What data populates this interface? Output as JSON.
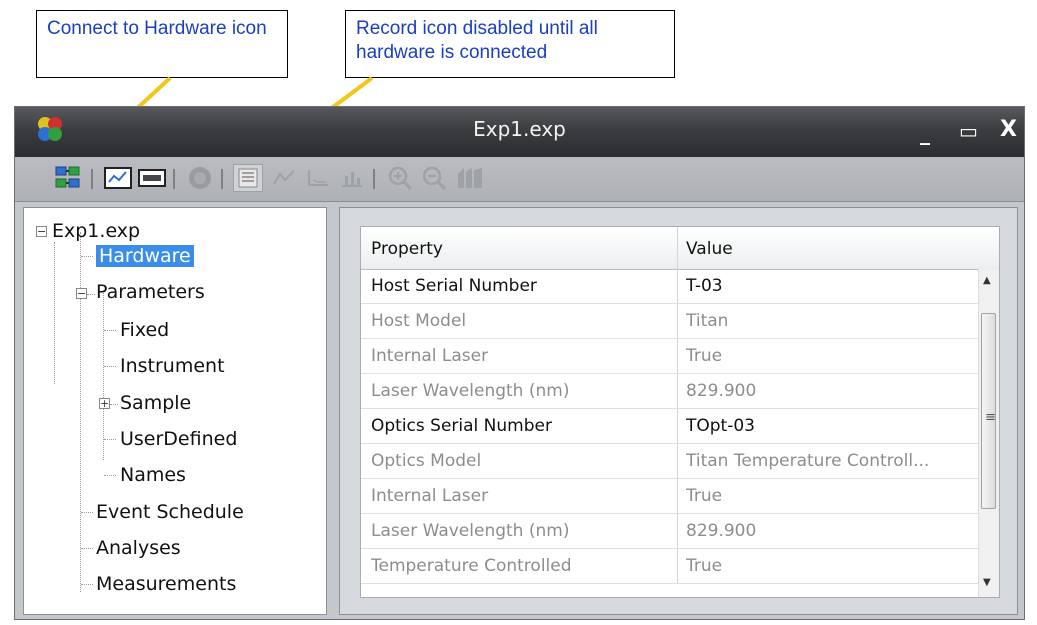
{
  "callouts": {
    "connect": "Connect to Hardware icon",
    "record": "Record icon disabled until all hardware is connected"
  },
  "colors": {
    "callout_text": "#1a3fbf",
    "arrow": "#f5c518",
    "selection": "#3a8ee8",
    "titlebar": "#3c3d41"
  },
  "window": {
    "title": "Exp1.exp",
    "controls": {
      "minimize": "_",
      "maximize": "▭",
      "close": "X"
    }
  },
  "toolbar": {
    "items": [
      {
        "icon": "connect-hardware-icon",
        "enabled": true
      },
      {
        "icon": "chart-view-icon",
        "enabled": true
      },
      {
        "icon": "panel-view-icon",
        "enabled": true
      },
      {
        "icon": "record-icon",
        "enabled": false
      },
      {
        "icon": "properties-list-icon",
        "enabled": false
      },
      {
        "icon": "line-chart-icon",
        "enabled": false
      },
      {
        "icon": "axis-chart-icon",
        "enabled": false
      },
      {
        "icon": "bar-chart-icon",
        "enabled": false
      },
      {
        "icon": "zoom-in-icon",
        "enabled": false
      },
      {
        "icon": "zoom-out-icon",
        "enabled": false
      },
      {
        "icon": "export-icon",
        "enabled": false
      }
    ]
  },
  "tree": {
    "root": "Exp1.exp",
    "hardware": "Hardware",
    "parameters": "Parameters",
    "fixed": "Fixed",
    "instrument": "Instrument",
    "sample": "Sample",
    "userdefined": "UserDefined",
    "names": "Names",
    "event_schedule": "Event Schedule",
    "analyses": "Analyses",
    "measurements": "Measurements",
    "selected": "Hardware"
  },
  "grid": {
    "headers": {
      "property": "Property",
      "value": "Value"
    },
    "rows": [
      {
        "property": "Host Serial Number",
        "value": "T-03",
        "enabled": true
      },
      {
        "property": "Host Model",
        "value": "Titan",
        "enabled": false
      },
      {
        "property": "Internal Laser",
        "value": "True",
        "enabled": false
      },
      {
        "property": "Laser Wavelength (nm)",
        "value": "829.900",
        "enabled": false
      },
      {
        "property": "Optics Serial Number",
        "value": "TOpt-03",
        "enabled": true
      },
      {
        "property": "Optics Model",
        "value": "Titan Temperature Controll...",
        "enabled": false
      },
      {
        "property": "Internal Laser",
        "value": "True",
        "enabled": false
      },
      {
        "property": "Laser Wavelength (nm)",
        "value": "829.900",
        "enabled": false
      },
      {
        "property": "Temperature Controlled",
        "value": "True",
        "enabled": false
      }
    ]
  }
}
